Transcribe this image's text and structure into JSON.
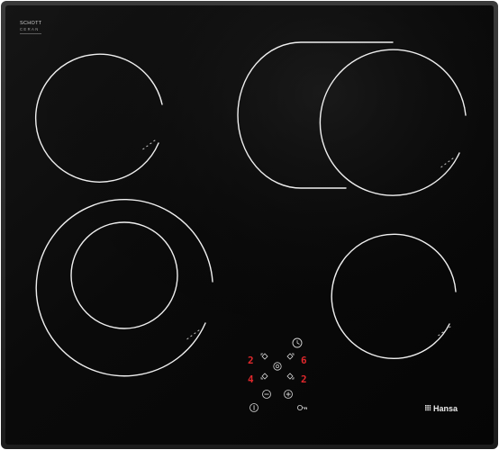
{
  "hob": {
    "surface_color": "#0b0b0b",
    "frame_color": "#2a2a2a",
    "ring_color": "#f2f2f2",
    "marking_color": "#cfcfcf",
    "glass_logo": {
      "line1": "SCHOTT",
      "line2": "CERAN"
    },
    "brand": "Hansa",
    "brand_icon": "hansa-grid-logo-icon",
    "display_color": "#e0282c",
    "zones": [
      {
        "id": "front-left",
        "type": "dual-circle"
      },
      {
        "id": "rear-left",
        "type": "single-circle"
      },
      {
        "id": "rear-right",
        "type": "oval-extension"
      },
      {
        "id": "front-right",
        "type": "single-circle"
      }
    ],
    "control_panel": {
      "zone_levels": [
        "2",
        "6",
        "4",
        "2"
      ],
      "timer_icon": "clock-icon",
      "minus_icon": "minus-icon",
      "plus_icon": "plus-icon",
      "power_icon": "power-icon",
      "lock_icon": "key-lock-icon",
      "selector_icon": "zone-selector-icon"
    }
  }
}
